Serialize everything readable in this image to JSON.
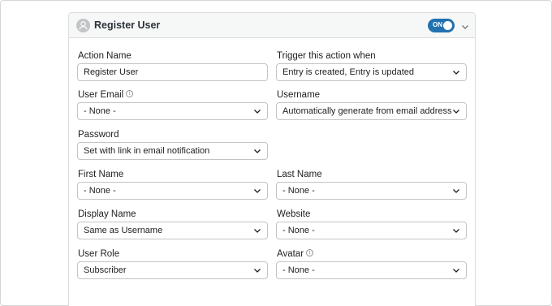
{
  "header": {
    "title": "Register User",
    "toggle_label": "ON",
    "toggle_state": "on",
    "user_icon": "user-icon",
    "chevron_icon": "chevron-down-icon"
  },
  "fields": {
    "action_name": {
      "label": "Action Name",
      "value": "Register User",
      "type": "text"
    },
    "trigger": {
      "label": "Trigger this action when",
      "value": "Entry is created, Entry is updated",
      "type": "select"
    },
    "user_email": {
      "label": "User Email",
      "value": "- None -",
      "type": "select",
      "info_icon": "info-icon"
    },
    "username": {
      "label": "Username",
      "value": "Automatically generate from email address",
      "type": "select"
    },
    "password": {
      "label": "Password",
      "value": "Set with link in email notification",
      "type": "select"
    },
    "first_name": {
      "label": "First Name",
      "value": "- None -",
      "type": "select"
    },
    "last_name": {
      "label": "Last Name",
      "value": "- None -",
      "type": "select"
    },
    "display_name": {
      "label": "Display Name",
      "value": "Same as Username",
      "type": "select"
    },
    "website": {
      "label": "Website",
      "value": "- None -",
      "type": "select"
    },
    "user_role": {
      "label": "User Role",
      "value": "Subscriber",
      "type": "select"
    },
    "avatar": {
      "label": "Avatar",
      "value": "- None -",
      "type": "select",
      "info_icon": "info-icon"
    }
  },
  "colors": {
    "accent": "#2271b1",
    "border": "#c3c4c7",
    "header_bg": "#f6f7f7"
  }
}
